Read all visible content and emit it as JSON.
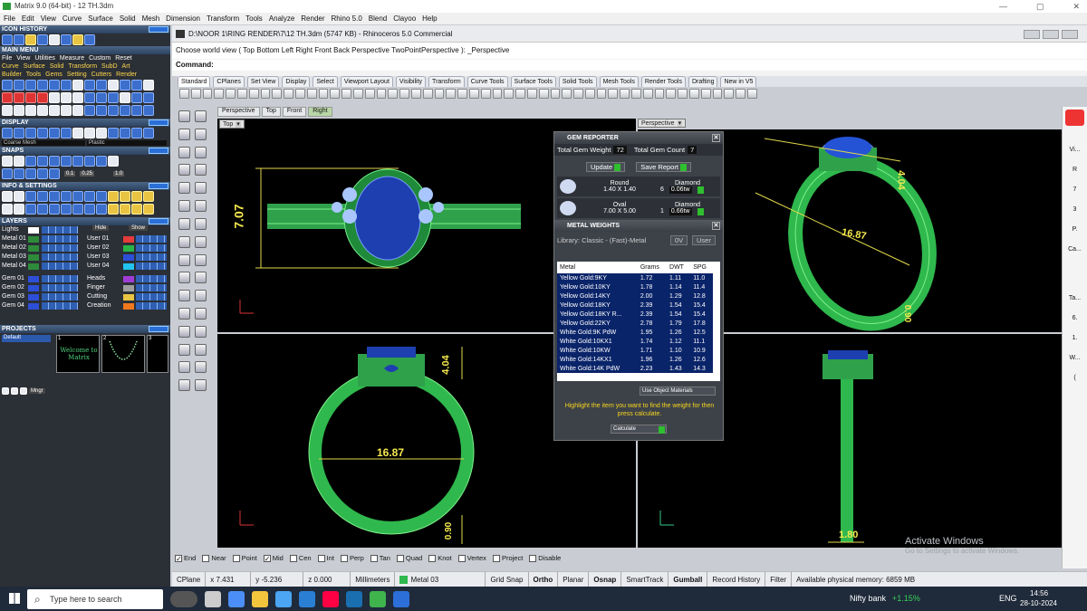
{
  "window": {
    "title": "Matrix 9.0 (64-bit) - 12 TH.3dm"
  },
  "menu": [
    "File",
    "Edit",
    "View",
    "Curve",
    "Surface",
    "Solid",
    "Mesh",
    "Dimension",
    "Transform",
    "Tools",
    "Analyze",
    "Render",
    "Rhino 5.0",
    "Blend",
    "Clayoo",
    "Help"
  ],
  "left": {
    "icon_history": "ICON HISTORY",
    "main_menu": "MAIN MENU",
    "main_menu_items": [
      "File",
      "View",
      "Utilities",
      "Measure",
      "Custom",
      "Reset"
    ],
    "builder_row1": [
      "Curve",
      "Surface",
      "Solid",
      "Transform",
      "SubD",
      "Art"
    ],
    "builder_row2": [
      "Builder",
      "Tools",
      "Gems",
      "Setting",
      "Cutters",
      "Render"
    ],
    "display": "DISPLAY",
    "display_modes": [
      "Coarse Mesh",
      "Plastic"
    ],
    "snaps": "SNAPS",
    "snap_vals": [
      "0.1",
      "0.25",
      "1.0"
    ],
    "info": "INFO & SETTINGS",
    "layers": "LAYERS",
    "layer_rows": [
      {
        "l": "Lights",
        "r": "",
        "lc": "#ffffff"
      },
      {
        "l": "Metal 01",
        "r": "User 01",
        "lc": "#2e8b3a",
        "rc": "#e43b3b"
      },
      {
        "l": "Metal 02",
        "r": "User 02",
        "lc": "#2e8b3a",
        "rc": "#27b548"
      },
      {
        "l": "Metal 03",
        "r": "User 03",
        "lc": "#2e8b3a",
        "rc": "#2d4fd8"
      },
      {
        "l": "Metal 04",
        "r": "User 04",
        "lc": "#2e8b3a",
        "rc": "#22c4ee"
      },
      {
        "l": "Gem 01",
        "r": "Heads",
        "lc": "#2d4fd8",
        "rc": "#a03cd6"
      },
      {
        "l": "Gem 02",
        "r": "Finger",
        "lc": "#2d4fd8",
        "rc": "#9e9e9e"
      },
      {
        "l": "Gem 03",
        "r": "Cutting",
        "lc": "#2d4fd8",
        "rc": "#e9c342"
      },
      {
        "l": "Gem 04",
        "r": "Creation",
        "lc": "#2d4fd8",
        "rc": "#f0781e"
      }
    ],
    "layer_hide": "Hide",
    "layer_show": "Show",
    "projects": "PROJECTS",
    "project_default": "Default",
    "project_thumbs": [
      "1",
      "2",
      "3"
    ],
    "project_welcome": "Welcome to Matrix",
    "mngr": "Mngr"
  },
  "doc": {
    "title": "D:\\NOOR 1\\RING RENDER\\7\\12 TH.3dm (5747 KB) - Rhinoceros 5.0 Commercial",
    "cmd_history": "Choose world view ( Top  Bottom  Left  Right  Front  Back  Perspective  TwoPointPerspective ): _Perspective",
    "cmd_label": "Command:"
  },
  "tabs": [
    "Standard",
    "CPlanes",
    "Set View",
    "Display",
    "Select",
    "Viewport Layout",
    "Visibility",
    "Transform",
    "Curve Tools",
    "Surface Tools",
    "Solid Tools",
    "Mesh Tools",
    "Render Tools",
    "Drafting",
    "New in V5"
  ],
  "view_tabs": [
    "Perspective",
    "Top",
    "Front",
    "Right"
  ],
  "viewports": {
    "top": {
      "label": "Top",
      "dims": [
        "7.07"
      ]
    },
    "perspective": {
      "label": "Perspective",
      "dims": [
        "16.87",
        "4.04",
        "0.90"
      ]
    },
    "front": {
      "label": "Front",
      "dims": [
        "16.87",
        "4.04",
        "0.90"
      ]
    },
    "right": {
      "dims": [
        "1.80"
      ]
    }
  },
  "gem_reporter": {
    "title": "GEM REPORTER",
    "total_weight_label": "Total Gem Weight",
    "total_weight": "72",
    "total_count_label": "Total Gem Count",
    "total_count": "7",
    "update": "Update",
    "save": "Save Report",
    "gems": [
      {
        "shape": "Round",
        "size": "1.40 X 1.40",
        "type": "Diamond",
        "count": "6",
        "tw": "0.06tw"
      },
      {
        "shape": "Oval",
        "size": "7.00 X 5.00",
        "type": "Diamond",
        "count": "1",
        "tw": "0.66tw"
      }
    ],
    "metal_title": "METAL WEIGHTS",
    "library": "Library: Classic - (Fast)-Metal",
    "lib_btn1": "0V",
    "lib_btn2": "User",
    "cols": [
      "Metal",
      "Grams",
      "DWT",
      "SPG"
    ],
    "rows": [
      [
        "Yellow Gold:9KY",
        "1.72",
        "1.11",
        "11.0"
      ],
      [
        "Yellow Gold:10KY",
        "1.78",
        "1.14",
        "11.4"
      ],
      [
        "Yellow Gold:14KY",
        "2.00",
        "1.29",
        "12.8"
      ],
      [
        "Yellow Gold:18KY",
        "2.39",
        "1.54",
        "15.4"
      ],
      [
        "Yellow Gold:18KY R...",
        "2.39",
        "1.54",
        "15.4"
      ],
      [
        "Yellow Gold:22KY",
        "2.78",
        "1.79",
        "17.8"
      ],
      [
        "White Gold:9K PdW",
        "1.95",
        "1.26",
        "12.5"
      ],
      [
        "White Gold:10KX1",
        "1.74",
        "1.12",
        "11.1"
      ],
      [
        "White Gold:10KW",
        "1.71",
        "1.10",
        "10.9"
      ],
      [
        "White Gold:14KX1",
        "1.96",
        "1.26",
        "12.6"
      ],
      [
        "White Gold:14K PdW",
        "2.23",
        "1.43",
        "14.3"
      ]
    ],
    "use_obj": "Use Object Materials",
    "hint": "Highlight the item you want to find the weight for then press calculate.",
    "calc": "Calculate"
  },
  "snaps_bar": [
    {
      "t": "End",
      "on": true
    },
    {
      "t": "Near",
      "on": false
    },
    {
      "t": "Point",
      "on": false
    },
    {
      "t": "Mid",
      "on": true
    },
    {
      "t": "Cen",
      "on": false
    },
    {
      "t": "Int",
      "on": false
    },
    {
      "t": "Perp",
      "on": false
    },
    {
      "t": "Tan",
      "on": false
    },
    {
      "t": "Quad",
      "on": false
    },
    {
      "t": "Knot",
      "on": false
    },
    {
      "t": "Vertex",
      "on": false
    },
    {
      "t": "Project",
      "on": false
    },
    {
      "t": "Disable",
      "on": false
    }
  ],
  "status": {
    "cplane": "CPlane",
    "x": "x 7.431",
    "y": "y -5.236",
    "z": "z 0.000",
    "units": "Millimeters",
    "layer": "Metal 03",
    "grid": "Grid Snap",
    "ortho": "Ortho",
    "planar": "Planar",
    "osnap": "Osnap",
    "smart": "SmartTrack",
    "gumball": "Gumball",
    "history": "Record History",
    "filter": "Filter",
    "memory": "Available physical memory: 6859 MB"
  },
  "activate": {
    "title": "Activate Windows",
    "sub": "Go to Settings to activate Windows."
  },
  "taskbar": {
    "search": "Type here to search",
    "stock": "Nifty bank",
    "stock_val": "+1.15%",
    "lang": "ENG",
    "time": "14:56",
    "date": "28-10-2024"
  },
  "right_panel": [
    "Vi...",
    "R",
    "7",
    "3",
    "P.",
    "Ca...",
    "Ta...",
    "6.",
    "1.",
    "W...",
    "("
  ]
}
